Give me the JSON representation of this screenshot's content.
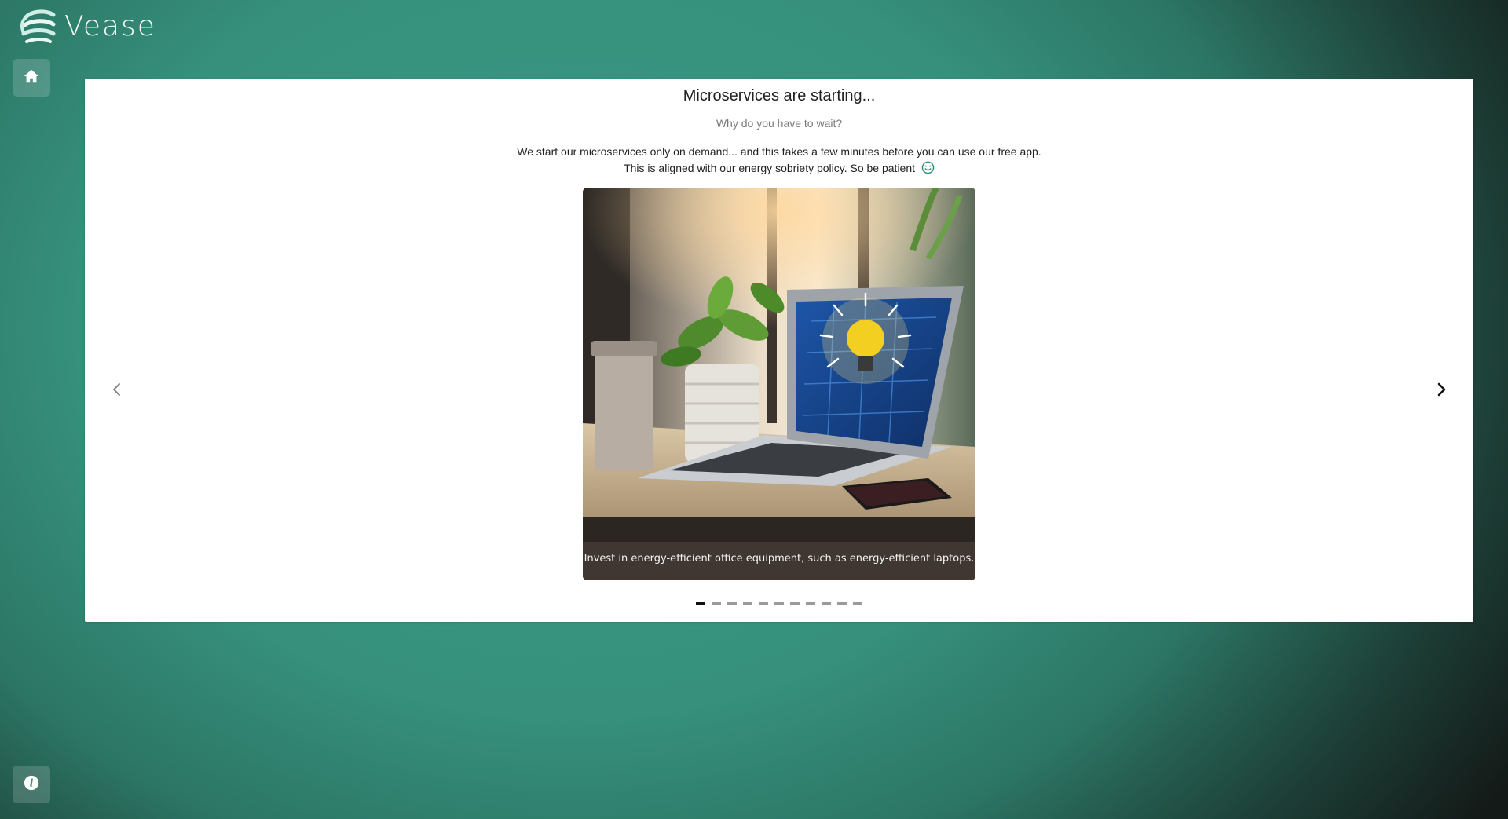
{
  "brand": {
    "name": "Vease",
    "logo_icon": "vease-swirl-logo-icon"
  },
  "sidebar": {
    "home": {
      "icon": "home-icon"
    },
    "info": {
      "icon": "info-icon"
    }
  },
  "loading_card": {
    "title": "Microservices are starting...",
    "subtitle": "Why do you have to wait?",
    "description_line1": "We start our microservices only on demand... and this takes a few minutes before you can use our free app.",
    "description_line2": "This is aligned with our energy sobriety policy. So be patient",
    "emoji_icon": "smile-icon"
  },
  "carousel": {
    "caption": "Invest in energy-efficient office equipment, such as energy-efficient laptops.",
    "prev_icon": "chevron-left-icon",
    "next_icon": "chevron-right-icon",
    "slide_count": 11,
    "active_index": 0
  },
  "colors": {
    "background_teal": "#3a9a85",
    "background_dark": "#141a18",
    "accent": "#2e8f78",
    "card": "#ffffff"
  }
}
